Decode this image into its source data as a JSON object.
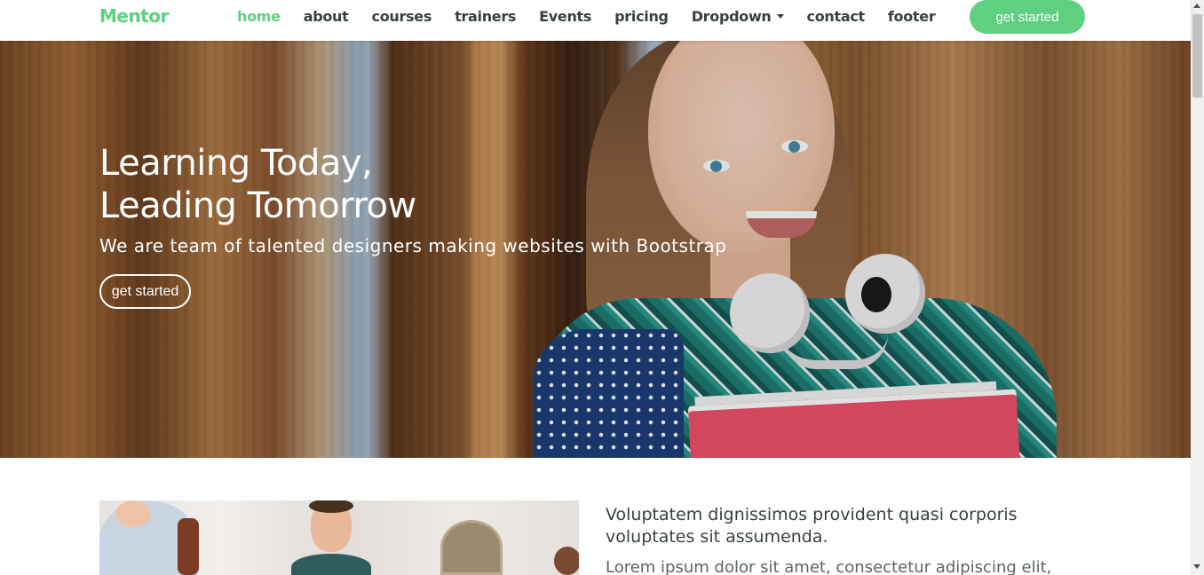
{
  "brand": {
    "logo": "Mentor",
    "accent_color": "#5fcf80"
  },
  "nav": {
    "items": [
      {
        "label": "home",
        "active": true
      },
      {
        "label": "about",
        "active": false
      },
      {
        "label": "courses",
        "active": false
      },
      {
        "label": "trainers",
        "active": false
      },
      {
        "label": "Events",
        "active": false
      },
      {
        "label": "pricing",
        "active": false
      },
      {
        "label": "Dropdown",
        "active": false,
        "has_dropdown": true
      },
      {
        "label": "contact",
        "active": false
      },
      {
        "label": "footer",
        "active": false
      }
    ],
    "cta_label": "get started"
  },
  "hero": {
    "title_line1": "Learning Today,",
    "title_line2": "Leading Tomorrow",
    "subtitle": "We are team of talented designers making websites with Bootstrap",
    "button_label": "get started"
  },
  "about": {
    "heading": "Voluptatem dignissimos provident quasi corporis voluptates sit assumenda.",
    "text": "Lorem ipsum dolor sit amet, consectetur adipiscing elit,"
  }
}
